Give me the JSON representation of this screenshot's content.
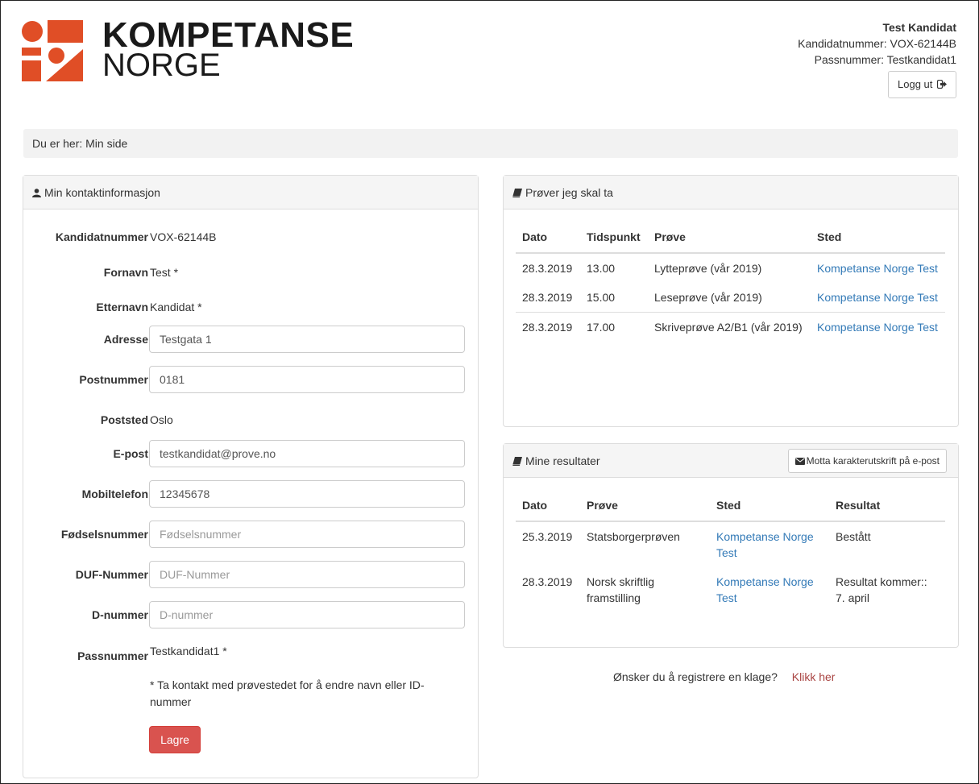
{
  "brand": {
    "line1": "KOMPETANSE",
    "line2": "NORGE",
    "color": "#e04e26"
  },
  "user": {
    "name": "Test Kandidat",
    "candidate_number": "Kandidatnummer: VOX-62144B",
    "passport_number": "Passnummer: Testkandidat1",
    "logout_label": "Logg ut"
  },
  "breadcrumb": "Du er her: Min side",
  "contact": {
    "title": "Min kontaktinformasjon",
    "fields": {
      "kandidatnummer": {
        "label": "Kandidatnummer",
        "value": "VOX-62144B"
      },
      "fornavn": {
        "label": "Fornavn",
        "value": "Test *"
      },
      "etternavn": {
        "label": "Etternavn",
        "value": "Kandidat *"
      },
      "adresse": {
        "label": "Adresse",
        "value": "Testgata 1",
        "placeholder": ""
      },
      "postnummer": {
        "label": "Postnummer",
        "value": "0181",
        "placeholder": ""
      },
      "poststed": {
        "label": "Poststed",
        "value": "Oslo"
      },
      "epost": {
        "label": "E-post",
        "value": "testkandidat@prove.no",
        "placeholder": ""
      },
      "mobiltelefon": {
        "label": "Mobiltelefon",
        "value": "12345678",
        "placeholder": ""
      },
      "fodselsnummer": {
        "label": "Fødselsnummer",
        "value": "",
        "placeholder": "Fødselsnummer"
      },
      "duf": {
        "label": "DUF-Nummer",
        "value": "",
        "placeholder": "DUF-Nummer"
      },
      "dnummer": {
        "label": "D-nummer",
        "value": "",
        "placeholder": "D-nummer"
      },
      "passnummer": {
        "label": "Passnummer",
        "value": "Testkandidat1 *"
      }
    },
    "note": "* Ta kontakt med prøvestedet for å endre navn eller ID-nummer",
    "save_label": "Lagre"
  },
  "tests": {
    "title": "Prøver jeg skal ta",
    "headers": [
      "Dato",
      "Tidspunkt",
      "Prøve",
      "Sted"
    ],
    "rows": [
      {
        "date": "28.3.2019",
        "time": "13.00",
        "test": "Lytteprøve (vår 2019)",
        "place": "Kompetanse Norge Test"
      },
      {
        "date": "28.3.2019",
        "time": "15.00",
        "test": "Leseprøve (vår 2019)",
        "place": "Kompetanse Norge Test"
      },
      {
        "date": "28.3.2019",
        "time": "17.00",
        "test": "Skriveprøve A2/B1 (vår 2019)",
        "place": "Kompetanse Norge Test"
      }
    ]
  },
  "results": {
    "title": "Mine resultater",
    "mail_button": "Motta karakterutskrift på e-post",
    "headers": [
      "Dato",
      "Prøve",
      "Sted",
      "Resultat"
    ],
    "rows": [
      {
        "date": "25.3.2019",
        "test": "Statsborgerprøven",
        "place": "Kompetanse Norge Test",
        "result": "Bestått"
      },
      {
        "date": "28.3.2019",
        "test": "Norsk skriftlig framstilling",
        "place": "Kompetanse Norge Test",
        "result": "Resultat kommer:: 7. april"
      }
    ]
  },
  "complaint": {
    "question": "Ønsker du å registrere en klage?",
    "link": "Klikk her"
  }
}
